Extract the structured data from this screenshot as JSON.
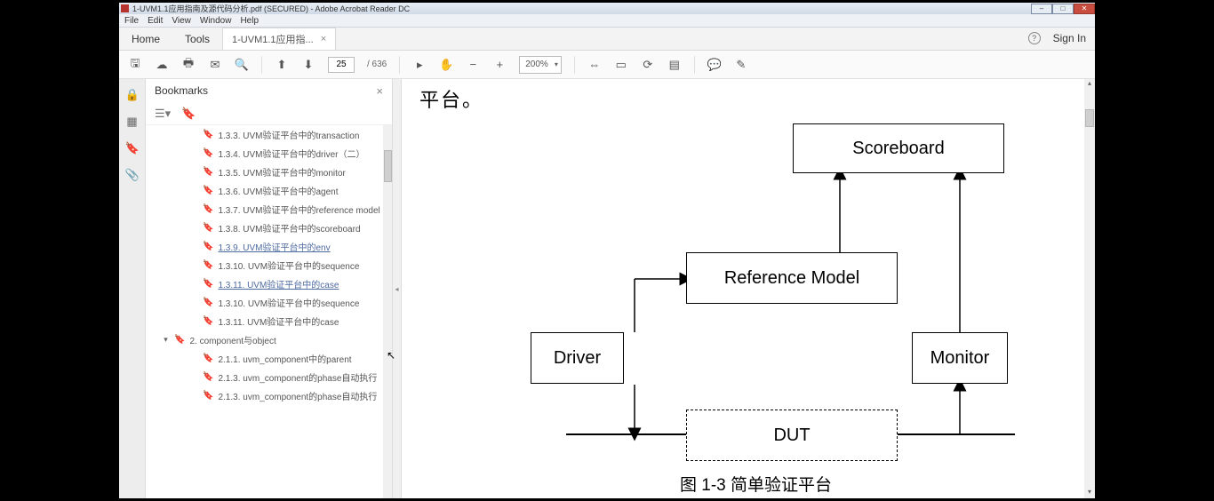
{
  "title": "1-UVM1.1应用指南及源代码分析.pdf (SECURED) - Adobe Acrobat Reader DC",
  "menu": {
    "file": "File",
    "edit": "Edit",
    "view": "View",
    "window": "Window",
    "help": "Help"
  },
  "tabs": {
    "home": "Home",
    "tools": "Tools",
    "doc": "1-UVM1.1应用指..."
  },
  "signin": "Sign In",
  "page": {
    "current": "25",
    "total": "/ 636"
  },
  "zoom": "200%",
  "bookmarks_title": "Bookmarks",
  "bookmarks": [
    {
      "lvl": 2,
      "t": "1.3.3. UVM验证平台中的transaction"
    },
    {
      "lvl": 2,
      "t": "1.3.4. UVM验证平台中的driver（二）"
    },
    {
      "lvl": 2,
      "t": "1.3.5. UVM验证平台中的monitor"
    },
    {
      "lvl": 2,
      "t": "1.3.6. UVM验证平台中的agent"
    },
    {
      "lvl": 2,
      "t": "1.3.7. UVM验证平台中的reference model"
    },
    {
      "lvl": 2,
      "t": "1.3.8. UVM验证平台中的scoreboard"
    },
    {
      "lvl": 2,
      "t": "1.3.9. UVM验证平台中的env",
      "link": true
    },
    {
      "lvl": 2,
      "t": "1.3.10. UVM验证平台中的sequence"
    },
    {
      "lvl": 2,
      "t": "1.3.11. UVM验证平台中的case",
      "link": true
    },
    {
      "lvl": 2,
      "t": "1.3.10. UVM验证平台中的sequence"
    },
    {
      "lvl": 2,
      "t": "1.3.11. UVM验证平台中的case"
    },
    {
      "lvl": 1,
      "t": "2. component与object",
      "exp": true
    },
    {
      "lvl": 2,
      "t": "2.1.1. uvm_component中的parent"
    },
    {
      "lvl": 2,
      "t": "2.1.3. uvm_component的phase自动执行"
    },
    {
      "lvl": 2,
      "t": "2.1.3. uvm_component的phase自动执行"
    }
  ],
  "chart_data": {
    "type": "diagram",
    "title": "图 1-3 简单验证平台",
    "header_fragment": "平台。",
    "nodes": [
      {
        "id": "scoreboard",
        "label": "Scoreboard"
      },
      {
        "id": "refmodel",
        "label": "Reference Model"
      },
      {
        "id": "driver",
        "label": "Driver"
      },
      {
        "id": "monitor",
        "label": "Monitor"
      },
      {
        "id": "dut",
        "label": "DUT",
        "style": "dashed"
      }
    ],
    "edges": [
      {
        "from": "driver",
        "to": "refmodel",
        "dir": "up-right"
      },
      {
        "from": "refmodel",
        "to": "scoreboard",
        "dir": "up"
      },
      {
        "from": "monitor",
        "to": "scoreboard",
        "dir": "up"
      },
      {
        "from": "driver",
        "to": "dut-bus",
        "dir": "down"
      },
      {
        "from": "dut-bus",
        "to": "monitor",
        "dir": "up"
      }
    ]
  }
}
